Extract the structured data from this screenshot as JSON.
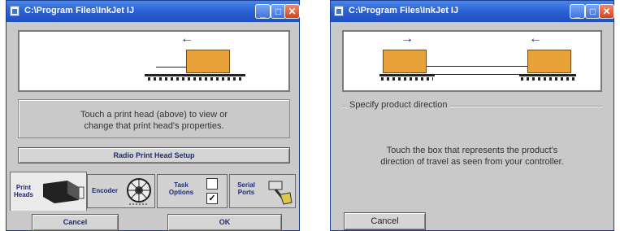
{
  "windows": [
    {
      "title": "C:\\Program Files\\InkJet  IJ",
      "controls": {
        "minimize": "_",
        "maximize": "□",
        "close": "✕"
      },
      "prompt_line1": "Touch a print head (above) to view or",
      "prompt_line2": "change that print head's properties.",
      "setup_button": "Radio Print Head Setup",
      "tabs": [
        {
          "line1": "Print",
          "line2": "Heads",
          "icon": "print-head-icon"
        },
        {
          "line1": "Encoder",
          "line2": "",
          "icon": "encoder-wheel-icon"
        },
        {
          "line1": "Task",
          "line2": "Options",
          "icon": "checkbox-icon"
        },
        {
          "line1": "Serial",
          "line2": "Ports",
          "icon": "serial-cable-icon"
        }
      ],
      "cancel_label": "Cancel",
      "ok_label": "OK",
      "arrow": "←"
    },
    {
      "title": "C:\\Program Files\\InkJet  IJ",
      "controls": {
        "minimize": "_",
        "maximize": "□",
        "close": "✕"
      },
      "group_label": "Specify product direction",
      "instruction_line1": "Touch the box that represents the product's",
      "instruction_line2": "direction of travel as seen from your controller.",
      "cancel_label": "Cancel",
      "arrow_right": "→",
      "arrow_left": "←"
    }
  ],
  "colors": {
    "titlebar": "#2c63d6",
    "box": "#e9a23a",
    "arrow": "#1a2a8c",
    "close": "#d9411f"
  }
}
